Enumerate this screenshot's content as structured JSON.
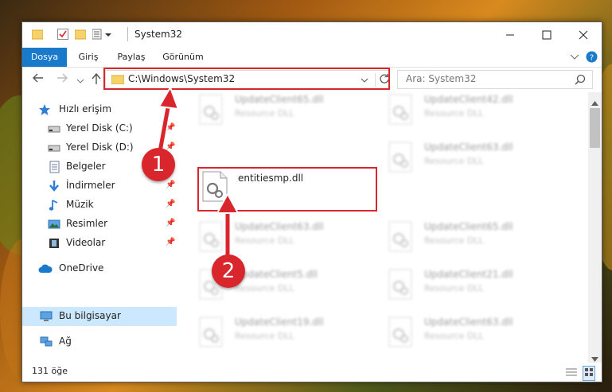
{
  "window": {
    "title": "System32"
  },
  "ribbon": {
    "tabs": [
      "Dosya",
      "Giriş",
      "Paylaş",
      "Görünüm"
    ]
  },
  "nav": {
    "address": "C:\\Windows\\System32",
    "search_placeholder": "Ara: System32"
  },
  "sidebar": {
    "items": [
      {
        "label": "Hızlı erişim"
      },
      {
        "label": "Yerel Disk (C:)"
      },
      {
        "label": "Yerel Disk (D:)"
      },
      {
        "label": "Belgeler"
      },
      {
        "label": "İndirmeler"
      },
      {
        "label": "Müzik"
      },
      {
        "label": "Resimler"
      },
      {
        "label": "Videolar"
      },
      {
        "label": "OneDrive"
      },
      {
        "label": "Bu bilgisayar"
      },
      {
        "label": "Ağ"
      }
    ]
  },
  "files": {
    "left": [
      {
        "name": "UpdateClient65.dll",
        "type": "Resource DLL"
      },
      {
        "name": "entitiesmp.dll",
        "type": ""
      },
      {
        "name": "UpdateClient63.dll",
        "type": "Resource DLL"
      },
      {
        "name": "UpdateClient5.dll",
        "type": "Resource DLL"
      },
      {
        "name": "UpdateClient19.dll",
        "type": "Resource DLL"
      }
    ],
    "right": [
      {
        "name": "UpdateClient42.dll",
        "type": "Resource DLL"
      },
      {
        "name": "UpdateClient63.dll",
        "type": "Resource DLL"
      },
      {
        "name": "UpdateClient65.dll",
        "type": "Resource DLL"
      },
      {
        "name": "UpdateClient21.dll",
        "type": "Resource DLL"
      },
      {
        "name": "UpdateClient63.dll",
        "type": "Resource DLL"
      }
    ]
  },
  "status": {
    "count": "131 öğe"
  },
  "callouts": [
    "1",
    "2"
  ],
  "colors": {
    "accent": "#1979ca",
    "highlight": "#d9262c",
    "selection": "#cce8ff"
  }
}
